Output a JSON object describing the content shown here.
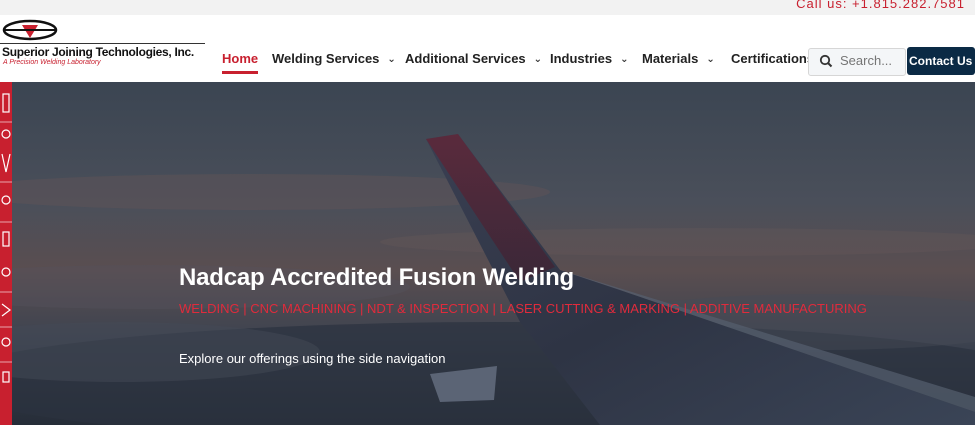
{
  "topbar": {
    "call_text": "Call us: +1.815.282.7581"
  },
  "logo": {
    "company": "Superior Joining Technologies, Inc.",
    "tagline": "A Precision Welding Laboratory"
  },
  "nav": {
    "items": [
      {
        "label": "Home",
        "active": true,
        "dropdown": false
      },
      {
        "label": "Welding Services",
        "dropdown": true
      },
      {
        "label": "Additional Services",
        "dropdown": true
      },
      {
        "label": "Industries",
        "dropdown": true
      },
      {
        "label": "Materials",
        "dropdown": true
      },
      {
        "label": "Certifications",
        "dropdown": false
      }
    ]
  },
  "search": {
    "placeholder": "Search..."
  },
  "contact": {
    "label": "Contact Us"
  },
  "hero": {
    "title": "Nadcap Accredited Fusion Welding",
    "subtitle": "WELDING | CNC MACHINING | NDT & INSPECTION | LASER CUTTING & MARKING | ADDITIVE MANUFACTURING",
    "description": "Explore our offerings using the side navigation"
  },
  "colors": {
    "brand_red": "#c8202f",
    "contact_bg": "#0b2a45",
    "hero_overlay": "#1c2430"
  }
}
